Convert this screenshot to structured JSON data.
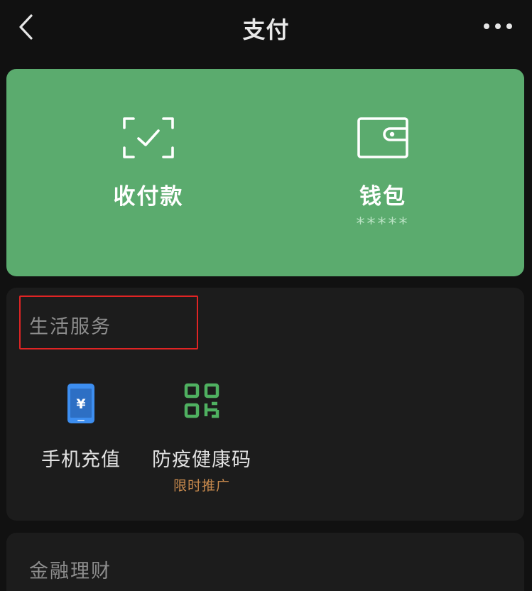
{
  "nav": {
    "title": "支付"
  },
  "hero": {
    "pay": {
      "label": "收付款"
    },
    "wallet": {
      "label": "钱包",
      "balance_mask": "*****"
    }
  },
  "life_services": {
    "title": "生活服务",
    "items": [
      {
        "label": "手机充值",
        "icon": "phone-yuan-icon"
      },
      {
        "label": "防疫健康码",
        "icon": "qr-code-icon",
        "promo": "限时推广"
      }
    ]
  },
  "finance": {
    "title": "金融理财"
  },
  "colors": {
    "background": "#111111",
    "hero_green": "#5bab6e",
    "card": "#1c1c1c",
    "phone_blue": "#3d8ef0",
    "qr_green": "#4fb060",
    "promo_orange": "#c98a4d",
    "highlight_red": "#e02424"
  }
}
